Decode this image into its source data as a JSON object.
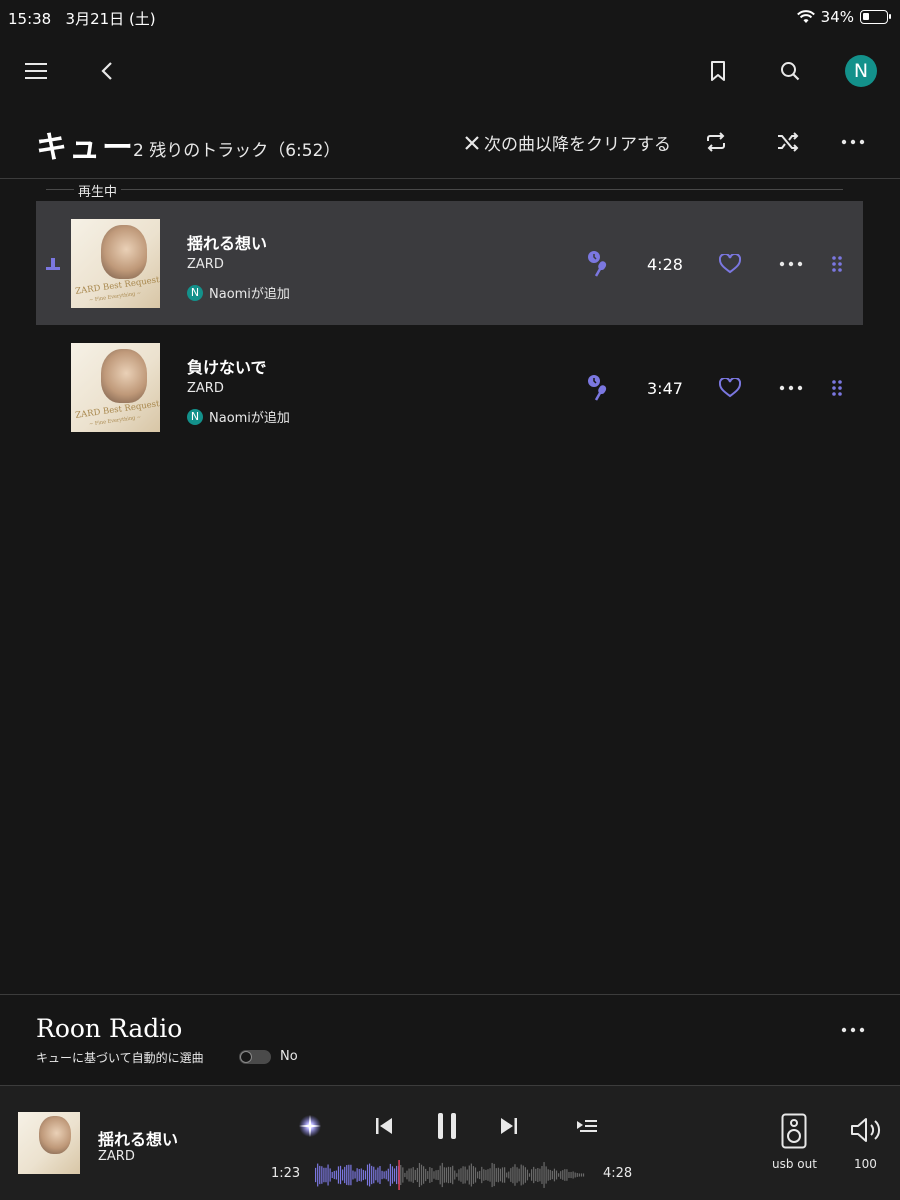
{
  "status_bar": {
    "time": "15:38",
    "date": "3月21日 (土)",
    "battery": "34%"
  },
  "user": {
    "initial": "N"
  },
  "queue": {
    "title": "キュー",
    "subtitle": "2 残りのトラック（6:52）",
    "clear_label": "次の曲以降をクリアする",
    "now_playing_label": "再生中",
    "tracks": [
      {
        "title": "揺れる想い",
        "artist": "ZARD",
        "added_by": "Naomiが追加",
        "duration": "4:28",
        "active": true
      },
      {
        "title": "負けないで",
        "artist": "ZARD",
        "added_by": "Naomiが追加",
        "duration": "3:47",
        "active": false
      }
    ]
  },
  "album_art": {
    "brand": "ZARD Best Request",
    "sub": "~ Fine Everything ~"
  },
  "radio": {
    "title": "Roon Radio",
    "subtitle": "キューに基づいて自動的に選曲",
    "toggle_state": "No"
  },
  "player": {
    "title": "揺れる想い",
    "artist": "ZARD",
    "elapsed": "1:23",
    "total": "4:28",
    "progress": 0.31,
    "zone": "usb out",
    "volume": "100"
  },
  "colors": {
    "accent": "#7b77e0",
    "avatar": "#13918b",
    "background": "#161616",
    "active_row": "#3b3b3e"
  }
}
